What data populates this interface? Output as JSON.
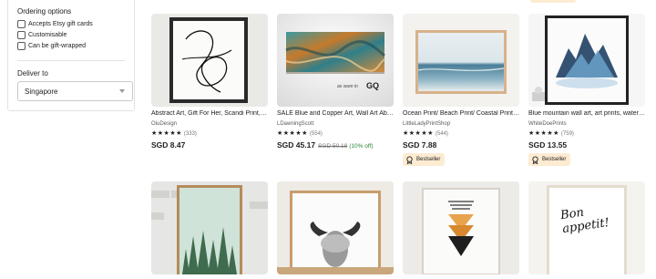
{
  "filters": {
    "ordering_heading": "Ordering options",
    "options": [
      {
        "label": "Accepts Etsy gift cards",
        "checked": false
      },
      {
        "label": "Customisable",
        "checked": false
      },
      {
        "label": "Can be gift-wrapped",
        "checked": false
      }
    ],
    "deliver_heading": "Deliver to",
    "deliver_value": "Singapore"
  },
  "listings": [
    {
      "title": "Abstract Art, Gift For Her, Scandi Print, Minimalist Line Art",
      "shop": "OiuDesign",
      "stars": "★★★★★",
      "reviews": "(333)",
      "price": "SGD 8.47",
      "original_price": "",
      "discount": "",
      "badge": "",
      "thumb_icon": "line-art-print-icon"
    },
    {
      "title": "SALE Blue and Copper Art, Wall Art Abstract Painting",
      "shop": "LDawningScott",
      "stars": "★★★★★",
      "reviews": "(554)",
      "price": "SGD 45.17",
      "original_price": "SGD 50.18",
      "discount": "(10% off)",
      "badge": "",
      "thumb_icon": "abstract-canvas-icon",
      "thumb_caption": "as seen in",
      "thumb_caption_brand": "GQ"
    },
    {
      "title": "Ocean Print/ Beach Print/ Coastal Print/ Sea Wall Art",
      "shop": "LittleLadyPrintShop",
      "stars": "★★★★★",
      "reviews": "(544)",
      "price": "SGD 7.88",
      "original_price": "",
      "discount": "",
      "badge": "Bestseller",
      "thumb_icon": "ocean-print-icon"
    },
    {
      "title": "Blue mountain wall art, art prints, watercolor landscape",
      "shop": "WhiteDoePrints",
      "stars": "★★★★★",
      "reviews": "(759)",
      "price": "SGD 13.55",
      "original_price": "",
      "discount": "",
      "badge": "Bestseller",
      "thumb_icon": "mountain-watercolor-icon"
    },
    {
      "thumb_icon": "forest-print-icon"
    },
    {
      "thumb_icon": "highland-cow-print-icon"
    },
    {
      "thumb_icon": "geometric-triangles-print-icon"
    },
    {
      "thumb_icon": "bon-appetit-print-icon",
      "thumb_text": "Bon appetit!"
    }
  ],
  "colors": {
    "badge_bg": "#fdebd2",
    "discount_green": "#2a8531",
    "text": "#222222",
    "muted": "#595959"
  }
}
